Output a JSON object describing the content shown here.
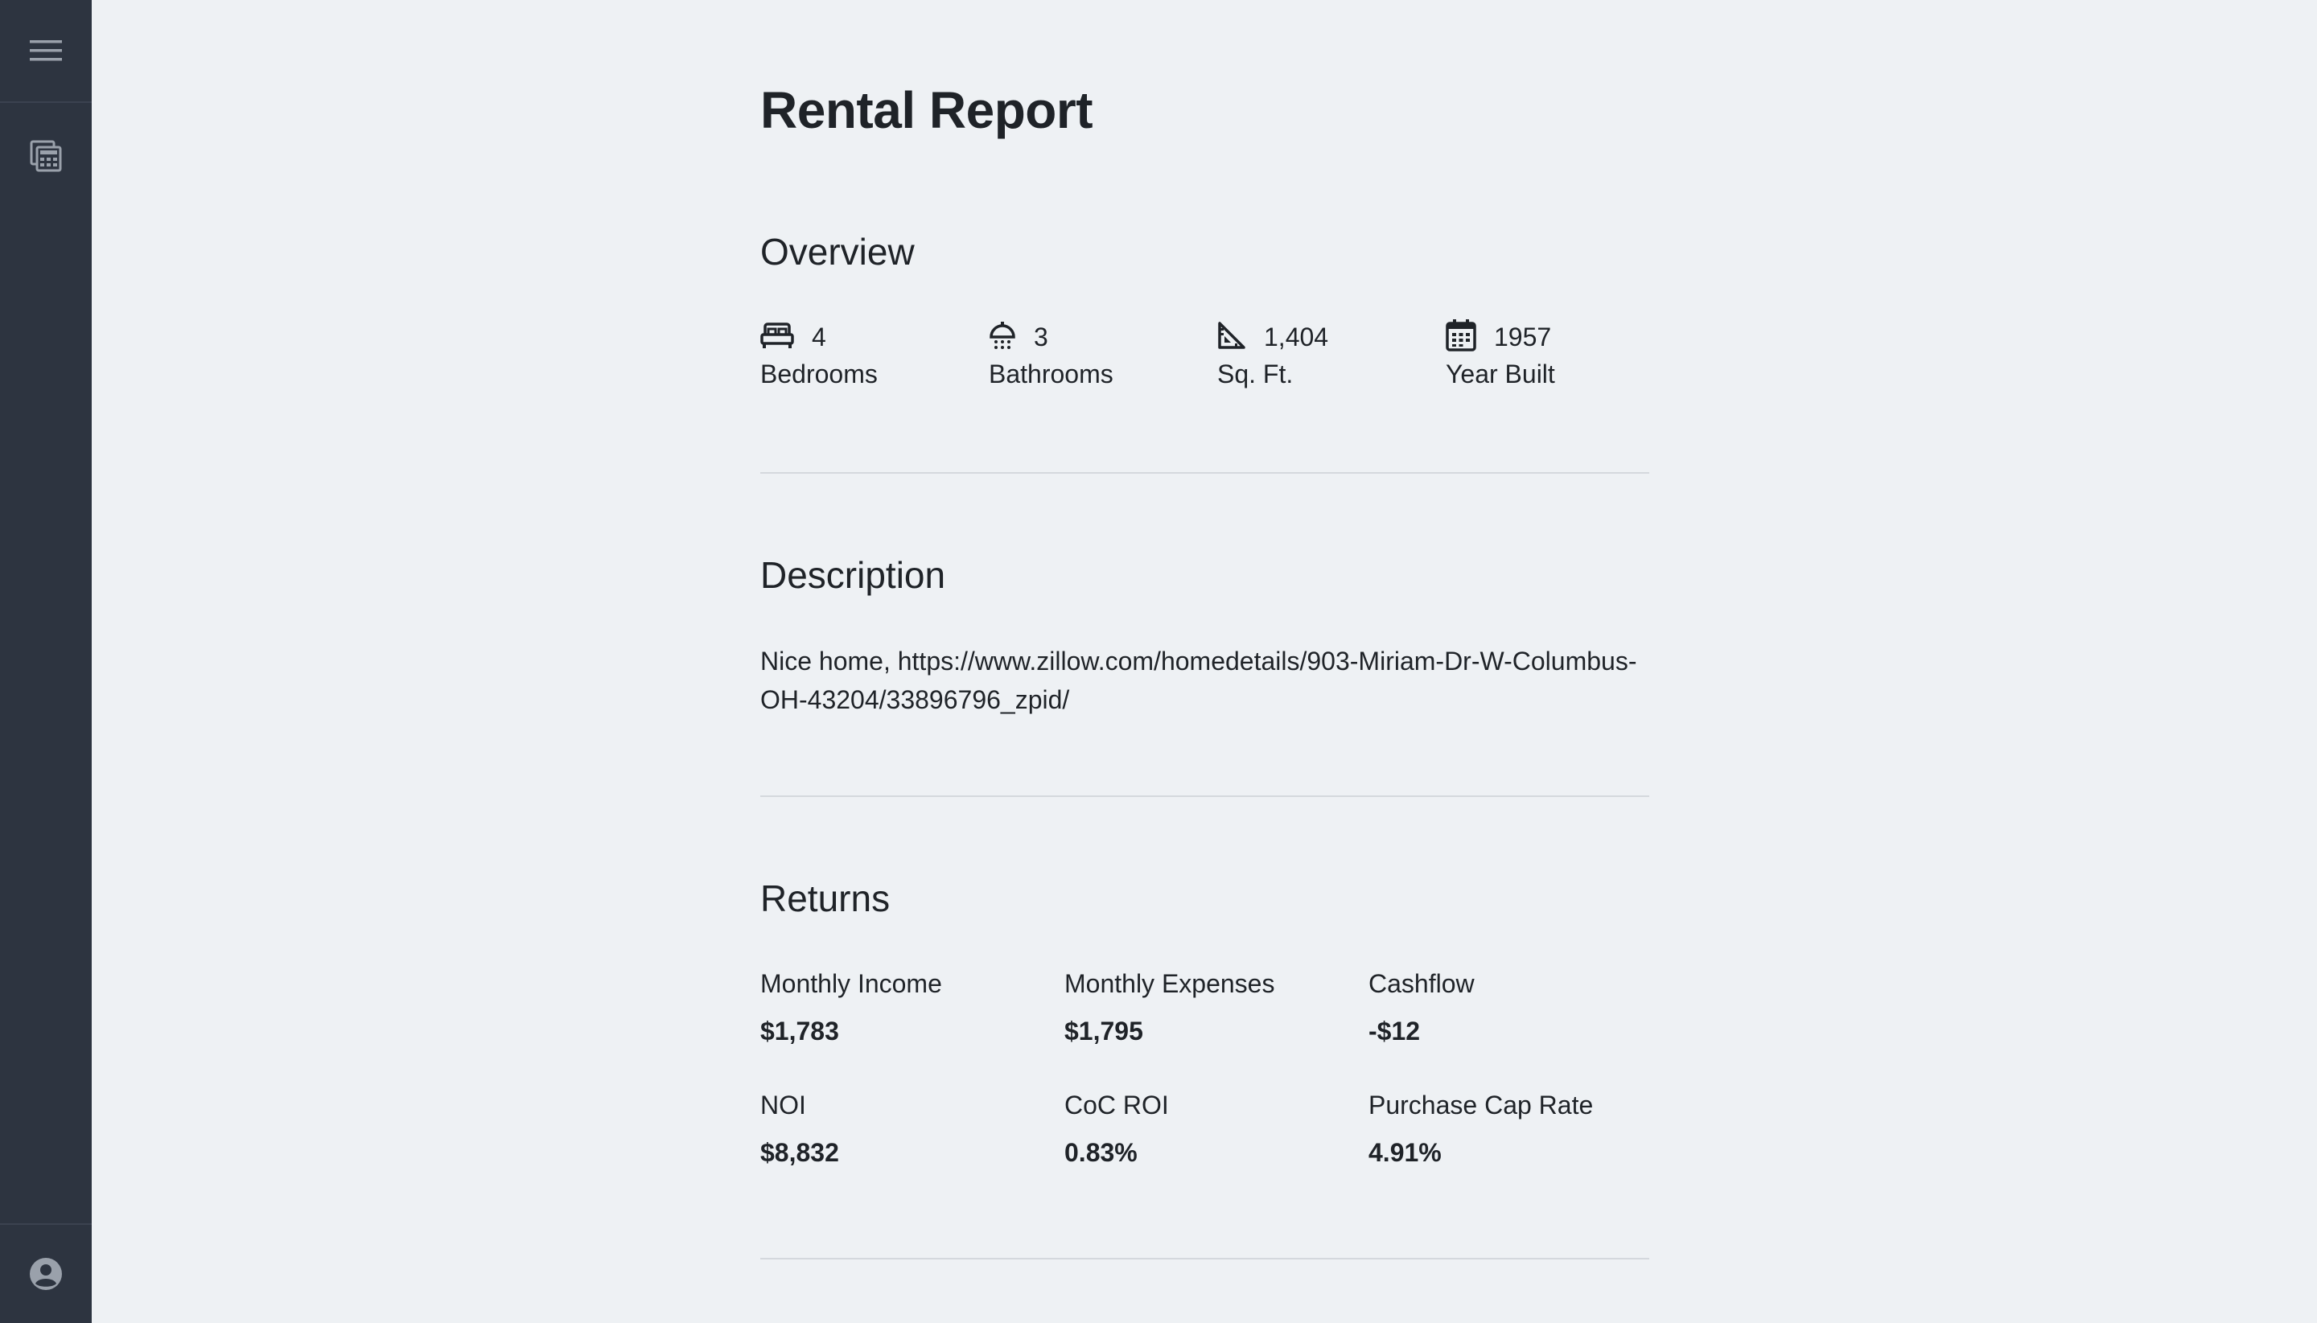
{
  "sidebar": {
    "icons": [
      "menu-icon",
      "calculator-icon",
      "account-icon"
    ],
    "colors": {
      "background": "#2d3440",
      "icon": "#9aa1ab"
    }
  },
  "page": {
    "title": "Rental Report"
  },
  "overview": {
    "title": "Overview",
    "stats": [
      {
        "icon": "bed-icon",
        "value": "4",
        "label": "Bedrooms"
      },
      {
        "icon": "shower-icon",
        "value": "3",
        "label": "Bathrooms"
      },
      {
        "icon": "ruler-triangle-icon",
        "value": "1,404",
        "label": "Sq. Ft."
      },
      {
        "icon": "calendar-icon",
        "value": "1957",
        "label": "Year Built"
      }
    ]
  },
  "description": {
    "title": "Description",
    "text": "Nice home, https://www.zillow.com/homedetails/903-Miriam-Dr-W-Columbus-OH-43204/33896796_zpid/"
  },
  "returns": {
    "title": "Returns",
    "metrics": [
      {
        "label": "Monthly Income",
        "value": "$1,783"
      },
      {
        "label": "Monthly Expenses",
        "value": "$1,795"
      },
      {
        "label": "Cashflow",
        "value": "-$12"
      },
      {
        "label": "NOI",
        "value": "$8,832"
      },
      {
        "label": "CoC ROI",
        "value": "0.83%"
      },
      {
        "label": "Purchase Cap Rate",
        "value": "4.91%"
      }
    ]
  }
}
